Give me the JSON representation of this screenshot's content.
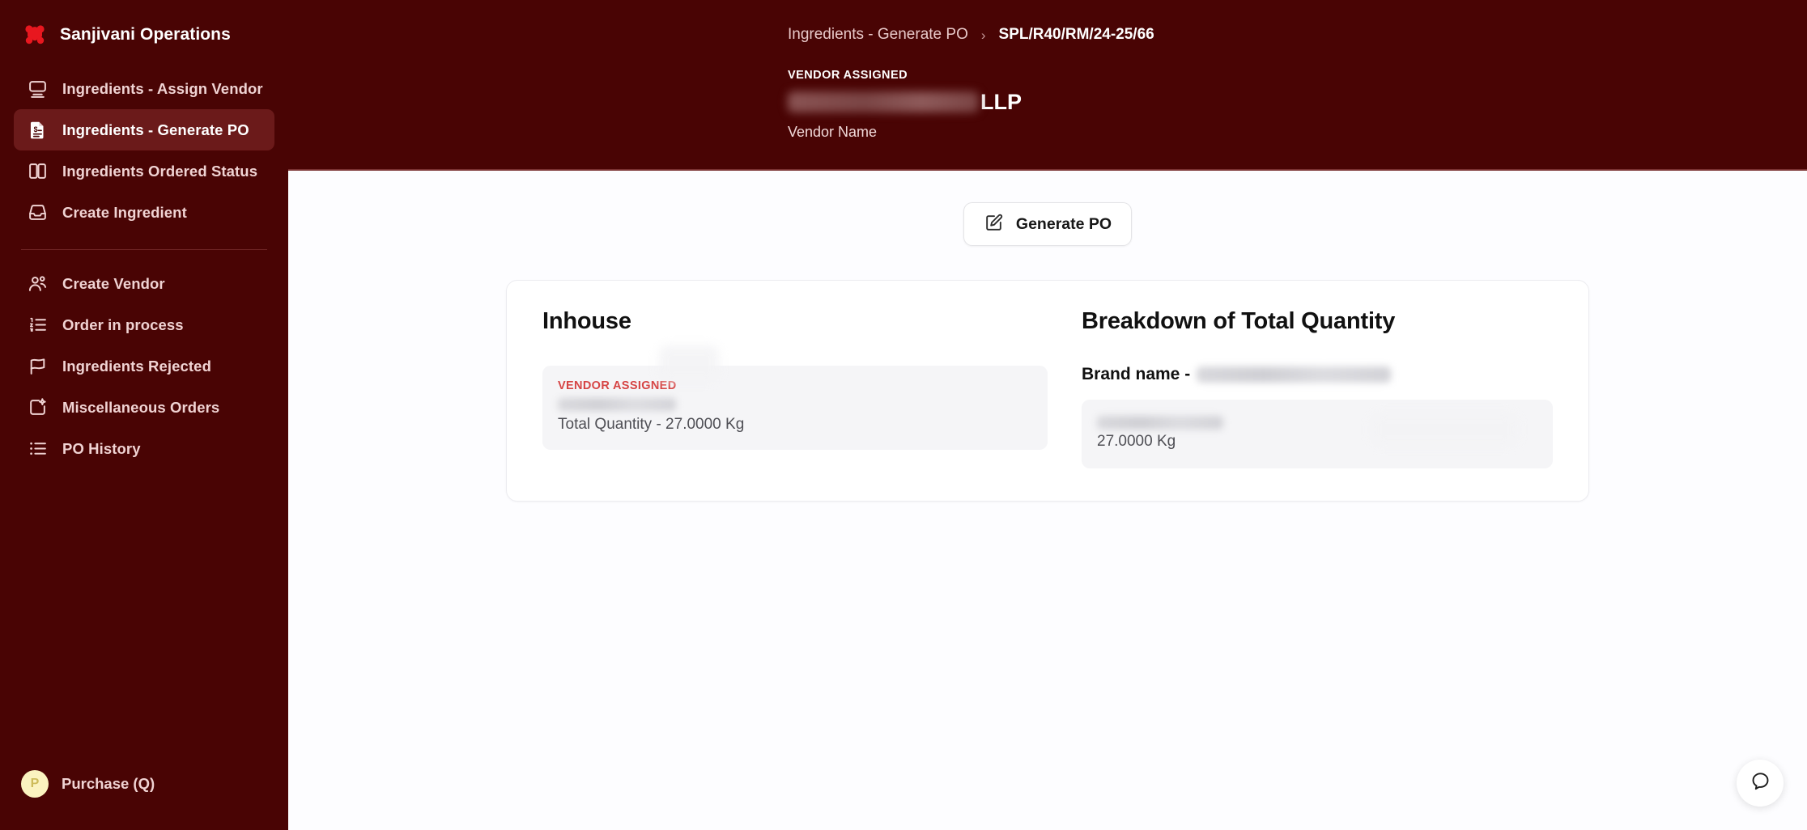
{
  "sidebar": {
    "brand": {
      "title": "Sanjivani Operations",
      "logo_icon": "molecule-cluster-logo"
    },
    "items": [
      {
        "label": "Ingredients - Assign Vendor",
        "icon": "monitor-icon",
        "active": false
      },
      {
        "label": "Ingredients - Generate PO",
        "icon": "file-dollar-icon",
        "active": true
      },
      {
        "label": "Ingredients Ordered Status",
        "icon": "book-open-icon",
        "active": false
      },
      {
        "label": "Create Ingredient",
        "icon": "inbox-download-icon",
        "active": false
      }
    ],
    "items_secondary": [
      {
        "label": "Create Vendor",
        "icon": "users-icon"
      },
      {
        "label": "Order in process",
        "icon": "list-ordered-icon"
      },
      {
        "label": "Ingredients Rejected",
        "icon": "flag-icon"
      },
      {
        "label": "Miscellaneous Orders",
        "icon": "package-sparkle-icon"
      },
      {
        "label": "PO History",
        "icon": "list-icon"
      }
    ],
    "user": {
      "initial": "P",
      "label": "Purchase (Q)"
    }
  },
  "header": {
    "breadcrumb_parent": "Ingredients - Generate PO",
    "breadcrumb_separator": "›",
    "breadcrumb_current": "SPL/R40/RM/24-25/66",
    "vendor_caption": "VENDOR ASSIGNED",
    "vendor_name_redacted": true,
    "vendor_name_suffix": "LLP",
    "vendor_sub_label": "Vendor Name"
  },
  "toolbar": {
    "generate_po_label": "Generate PO",
    "generate_po_icon": "square-pen-icon"
  },
  "panel": {
    "inhouse": {
      "heading": "Inhouse",
      "badge": "VENDOR ASSIGNED",
      "vendor_name_redacted": true,
      "quantity_line": "Total Quantity - 27.0000 Kg"
    },
    "breakdown": {
      "heading": "Breakdown of Total Quantity",
      "brand_label": "Brand name -",
      "brand_value_redacted": true,
      "item_name_redacted": true,
      "quantity_line": "27.0000 Kg"
    }
  },
  "chat": {
    "icon": "chat-bubble-icon"
  },
  "colors": {
    "sidebar_bg": "#490404",
    "sidebar_active": "#6b1a1a",
    "sidebar_text": "#f0d3d3",
    "accent_red": "#d64545",
    "content_bg": "#fdfdff",
    "card_bg": "#ffffff",
    "inner_box_bg": "#f5f5f7",
    "avatar_bg": "#fbf3c0"
  }
}
